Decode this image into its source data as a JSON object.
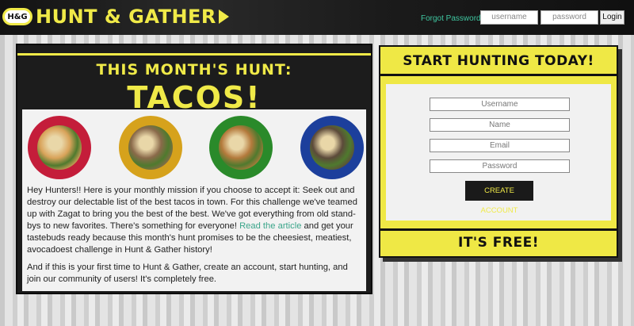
{
  "header": {
    "logo_badge": "H&G",
    "logo_text": "HUNT & GATHER",
    "forgot_password": "Forgot Password",
    "username_placeholder": "username",
    "password_placeholder": "password",
    "login_label": "Login"
  },
  "hunt": {
    "subtitle": "THIS MONTH'S HUNT:",
    "title": "TACOS!",
    "plates": [
      {
        "rim": "#c41d3a",
        "food": "#d9a35a"
      },
      {
        "rim": "#d6a21c",
        "food": "#8a6a4a"
      },
      {
        "rim": "#2a8a2a",
        "food": "#b47a3c"
      },
      {
        "rim": "#1c3f9c",
        "food": "#5c4a3a"
      }
    ],
    "para1_a": "Hey Hunters!! Here is your monthly mission if you choose to accept it: Seek out and destroy our delectable list of the best tacos in town. For this challenge we've teamed up with Zagat to bring you the best of the best. We've got everything from old stand-bys to new favorites. There's something for everyone! ",
    "para1_link": "Read the article",
    "para1_b": " and get your tastebuds ready because this month's hunt promises to be the cheesiest, meatiest, avocadoest challenge in Hunt & Gather history!",
    "para2": "And if this is your first time to Hunt & Gather, create an account, start hunting, and join our community of users! It's completely free."
  },
  "signup": {
    "title": "START HUNTING TODAY!",
    "fields": [
      "Username",
      "Name",
      "Email",
      "Password"
    ],
    "button_label": "CREATE ACCOUNT",
    "footer": "IT'S FREE!"
  },
  "colors": {
    "accent": "#f0ea48",
    "link": "#3aa58a",
    "dark": "#1c1c1c"
  }
}
